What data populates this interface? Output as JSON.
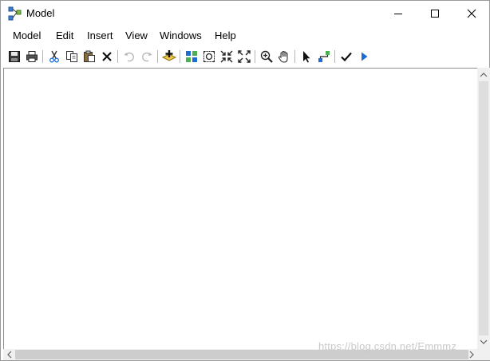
{
  "window": {
    "title": "Model",
    "controls": {
      "minimize": "minimize-icon",
      "maximize": "maximize-icon",
      "close": "close-icon"
    }
  },
  "menubar": {
    "items": [
      {
        "label": "Model"
      },
      {
        "label": "Edit"
      },
      {
        "label": "Insert"
      },
      {
        "label": "View"
      },
      {
        "label": "Windows"
      },
      {
        "label": "Help"
      }
    ]
  },
  "toolbar": {
    "icons": [
      "save-icon",
      "print-icon",
      "cut-icon",
      "copy-icon",
      "paste-icon",
      "delete-icon",
      "undo-icon",
      "redo-icon",
      "add-data-icon",
      "auto-layout-icon",
      "full-extent-icon",
      "zoom-in-fixed-icon",
      "zoom-out-fixed-icon",
      "zoom-icon",
      "pan-icon",
      "select-icon",
      "connect-icon",
      "validate-icon",
      "run-icon"
    ]
  },
  "colors": {
    "accent": "#1e6bd6",
    "icon_dark": "#1a1a1a",
    "icon_disabled": "#b8b8b8",
    "add_yellow": "#f2c84b"
  },
  "watermark": {
    "text": "https://blog.csdn.net/Emmmz"
  }
}
